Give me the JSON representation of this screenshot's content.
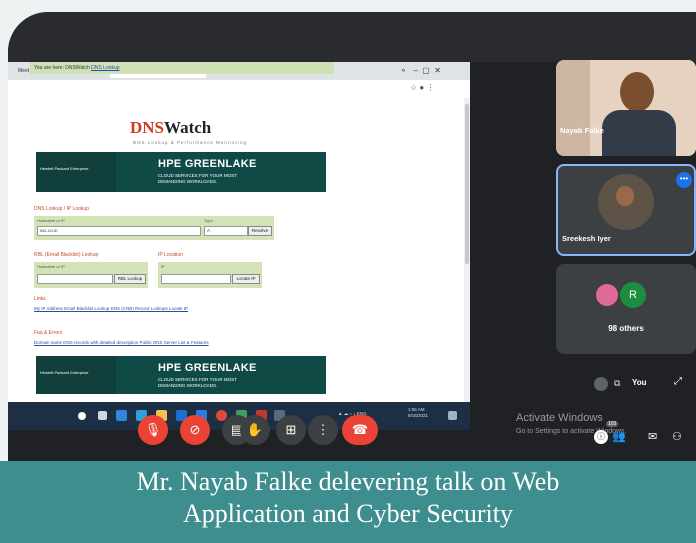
{
  "browser": {
    "tabs": [
      "Meet - gpo-rose-hnz",
      "DNS Lookup and Domain DNS"
    ],
    "tab_add": "+"
  },
  "page": {
    "breadcrumb_prefix": "You are here:",
    "breadcrumb_home": "DNSWatch",
    "breadcrumb_link": "DNS Lookup",
    "logo_dns": "DNS",
    "logo_watch": "Watch",
    "tagline": "DNS Lookup & Performance Monitoring",
    "ad": {
      "brand": "Hewlett Packard Enterprise",
      "headline": "HPE GREENLAKE",
      "subline1": "CLOUD SERVICES FOR YOUR MOST",
      "subline2": "DEMANDING WORKLOADS."
    },
    "dns_lookup": {
      "heading": "DNS Lookup / IP Lookup",
      "label": "Hostname or IP",
      "type_label": "Type",
      "value": "sxc.co.in",
      "type_value": "A",
      "button": "Resolve"
    },
    "rbl": {
      "heading": "RBL (Email Blacklist) Lookup",
      "label": "Hostname or IP",
      "button": "RBL Lookup"
    },
    "ip_location": {
      "heading": "IP Location",
      "label": "IP",
      "button": "Locate IP"
    },
    "links_heading": "Links",
    "links_text": "My IP Address   Email Blacklist Lookup   DNS (CNB) Record Lookups   Locate IP",
    "faq_heading": "Faq & Errors",
    "faq_text": "Domain name DNS records with detailed description   Public DNS Server List & Features"
  },
  "taskbar": {
    "time": "1:55 AM",
    "date": "8/16/2021"
  },
  "participants": [
    {
      "name": "Nayab Falke"
    },
    {
      "name": "Sreekesh Iyer"
    },
    {
      "initial": "R",
      "label": "98 others"
    }
  ],
  "self_view": {
    "label": "You"
  },
  "controls": [
    "mic-off",
    "camera-off",
    "captions",
    "raise-hand",
    "present",
    "more",
    "leave-call"
  ],
  "watermark": {
    "line1": "Activate Windows",
    "line2": "Go to Settings to activate Windows."
  },
  "side_badge": "103",
  "caption": {
    "line1": "Mr. Nayab Falke delevering talk on Web",
    "line2": "Application  and Cyber Security"
  },
  "colors": {
    "meet_bg": "#202124",
    "end_call": "#ea4335",
    "caption_bg": "#3e8e8f",
    "accent_blue": "#1a73e8"
  }
}
